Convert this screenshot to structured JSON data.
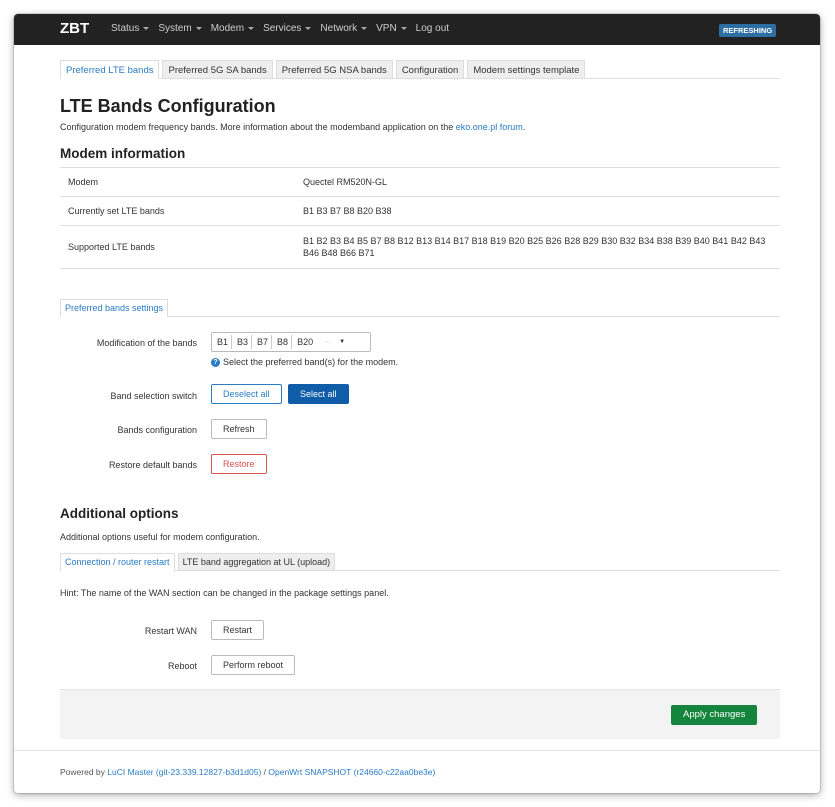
{
  "navbar": {
    "brand": "ZBT",
    "menu": [
      "Status",
      "System",
      "Modem",
      "Services",
      "Network",
      "VPN"
    ],
    "logout": "Log out",
    "status_badge": "REFRESHING"
  },
  "tabs": [
    "Preferred LTE bands",
    "Preferred 5G SA bands",
    "Preferred 5G NSA bands",
    "Configuration",
    "Modem settings template"
  ],
  "page": {
    "title": "LTE Bands Configuration",
    "desc_text": "Configuration modem frequency bands. More information about the modemband application on the ",
    "desc_link": "eko.one.pl forum",
    "desc_end": "."
  },
  "modem_info": {
    "heading": "Modem information",
    "rows": [
      {
        "label": "Modem",
        "value": "Quectel RM520N-GL"
      },
      {
        "label": "Currently set LTE bands",
        "value": "B1 B3 B7 B8 B20 B38"
      },
      {
        "label": "Supported LTE bands",
        "value": "B1 B2 B3 B4 B5 B7 B8 B12 B13 B14 B17 B18 B19 B20 B25 B26 B28 B29 B30 B32 B34 B38 B39 B40 B41 B42 B43 B46 B48 B66 B71"
      }
    ]
  },
  "preferred": {
    "tab": "Preferred bands settings",
    "modification_label": "Modification of the bands",
    "selected_bands": [
      "B1",
      "B3",
      "B7",
      "B8",
      "B20"
    ],
    "more": "···",
    "help": "Select the preferred band(s) for the modem.",
    "switch_label": "Band selection switch",
    "deselect_all": "Deselect all",
    "select_all": "Select all",
    "config_label": "Bands configuration",
    "refresh": "Refresh",
    "restore_label": "Restore default bands",
    "restore": "Restore"
  },
  "additional": {
    "heading": "Additional options",
    "desc": "Additional options useful for modem configuration.",
    "tabs": [
      "Connection / router restart",
      "LTE band aggregation at UL (upload)"
    ],
    "hint": "Hint: The name of the WAN section can be changed in the package settings panel.",
    "restart_wan_label": "Restart WAN",
    "restart": "Restart",
    "reboot_label": "Reboot",
    "perform_reboot": "Perform reboot"
  },
  "apply": "Apply changes",
  "footer": {
    "prefix": "Powered by ",
    "luci": "LuCI Master (git-23.339.12827-b3d1d05)",
    "sep": " / ",
    "openwrt": "OpenWrt SNAPSHOT (r24660-c22aa0be3e)"
  }
}
